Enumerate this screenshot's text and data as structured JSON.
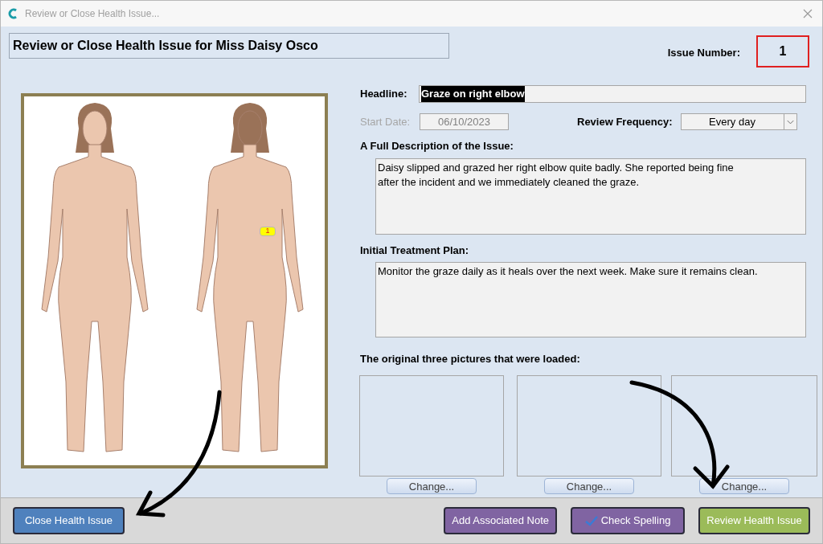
{
  "window": {
    "title": "Review or Close Health Issue..."
  },
  "header": "Review or Close Health Issue for Miss Daisy Osco",
  "issue_number": {
    "label": "Issue Number:",
    "value": "1"
  },
  "body_map": {
    "markers": [
      {
        "label": "1"
      }
    ]
  },
  "headline": {
    "label": "Headline:",
    "value": "Graze on right elbow",
    "highlighted": true
  },
  "start_date": {
    "label": "Start Date:",
    "value": "06/10/2023",
    "disabled": true
  },
  "review_frequency": {
    "label": "Review Frequency:",
    "value": "Every day"
  },
  "description": {
    "label": "A Full Description of the Issue:",
    "value": "Daisy slipped and grazed her right elbow quite badly. She reported being fine after the incident and we immediately cleaned the graze."
  },
  "treatment_plan": {
    "label": "Initial Treatment Plan:",
    "value": "Monitor the graze daily as it heals over the next week. Make sure it remains clean."
  },
  "pictures": {
    "label": "The original three pictures that were loaded:",
    "slots": [
      {
        "button": "Change..."
      },
      {
        "button": "Change..."
      },
      {
        "button": "Change..."
      }
    ]
  },
  "buttons": [
    {
      "label": "Close Health Issue",
      "color": "#4f81bd",
      "kind": "plain"
    },
    {
      "label": "Add Associated Note",
      "color": "#8064a2",
      "kind": "plain"
    },
    {
      "label": "Check Spelling",
      "color": "#8064a2",
      "kind": "spellcheck"
    },
    {
      "label": "Review Health Issue",
      "color": "#9bbb59",
      "kind": "plain"
    }
  ]
}
